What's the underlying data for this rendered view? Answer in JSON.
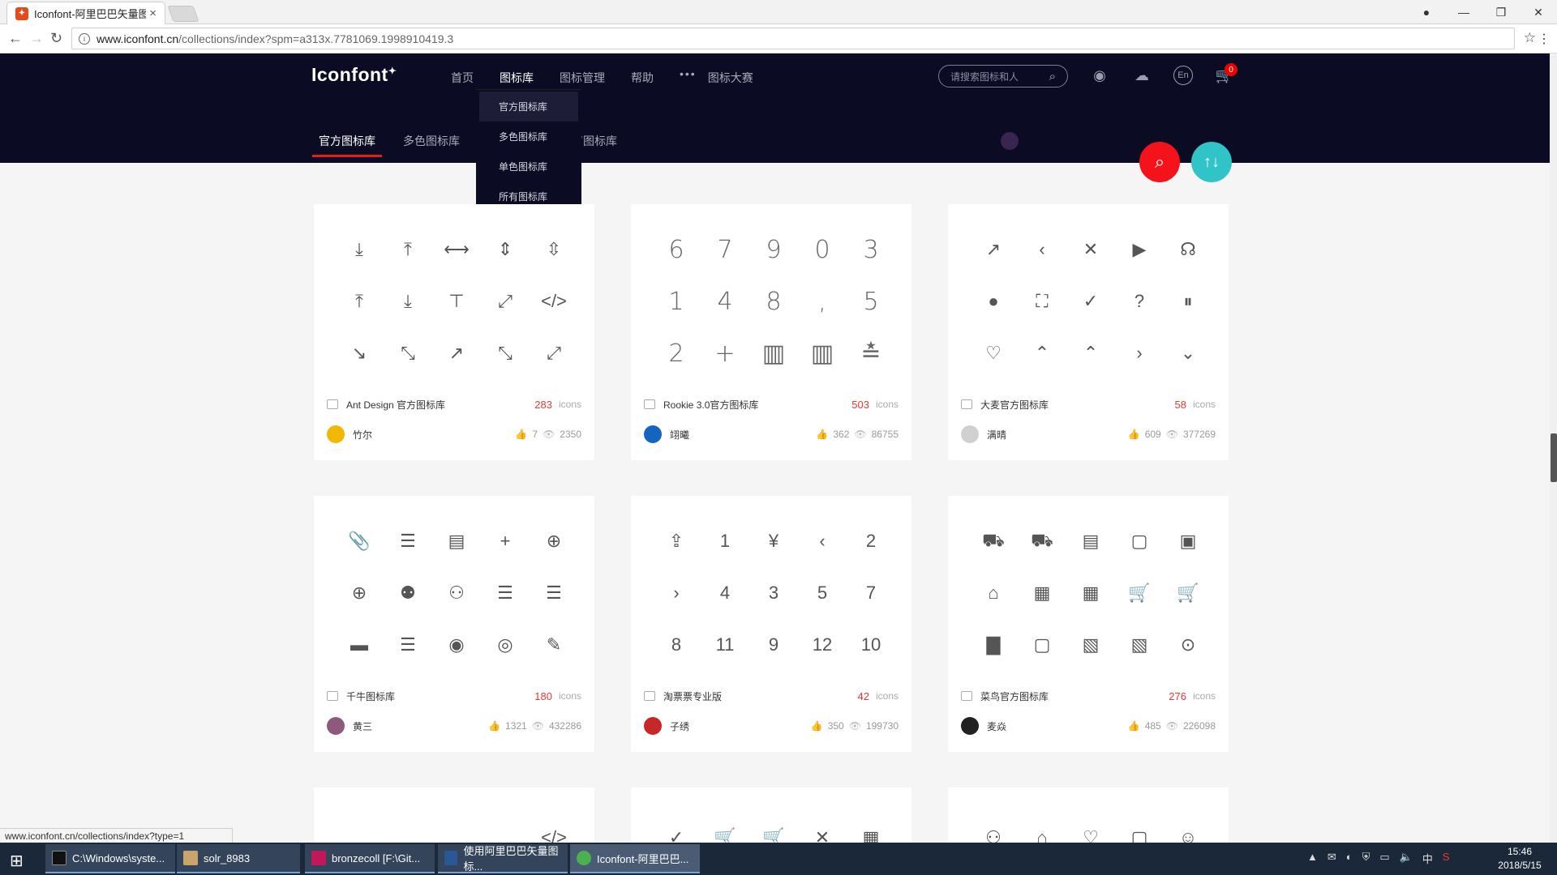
{
  "browser": {
    "tab_title": "Iconfont-阿里巴巴矢量图标",
    "tab_close": "×",
    "url_host": "www.iconfont.cn",
    "url_path": "/collections/index?spm=a313x.7781069.1998910419.3",
    "status_url": "www.iconfont.cn/collections/index?type=1"
  },
  "site": {
    "logo": "Iconfont",
    "nav": [
      "首页",
      "图标库",
      "图标管理",
      "帮助",
      "图标大赛"
    ],
    "nav_more": "•••",
    "search_placeholder": "请搜索图标和人",
    "lang": "En",
    "cart_count": "0",
    "subnav": [
      "官方图标库",
      "多色图标库",
      "所有图标库"
    ],
    "dropdown": [
      "官方图标库",
      "多色图标库",
      "单色图标库",
      "所有图标库"
    ]
  },
  "cards": [
    {
      "name": "Ant Design 官方图标库",
      "count": "283",
      "label": "icons",
      "author": "竹尔",
      "likes": "7",
      "views": "2350",
      "icons": [
        "⤓",
        "⤒",
        "⟷",
        "⇕",
        "⇳",
        "⤒",
        "⤓",
        "⊤",
        "⤢",
        "</>",
        "↘",
        "⤡",
        "↗",
        "⤡",
        "⤢"
      ],
      "avatar_color": "#f2b705"
    },
    {
      "name": "Rookie 3.0官方图标库",
      "count": "503",
      "label": "icons",
      "author": "翊曦",
      "likes": "362",
      "views": "86755",
      "icons": [
        "6",
        "7",
        "9",
        "0",
        "3",
        "1",
        "4",
        "8",
        ",",
        "5",
        "2",
        "+",
        "▥",
        "▥",
        "≛"
      ],
      "avatar_color": "#1565c0",
      "numeric": true
    },
    {
      "name": "大麦官方图标库",
      "count": "58",
      "label": "icons",
      "author": "满晴",
      "likes": "609",
      "views": "377269",
      "icons": [
        "↗",
        "‹",
        "✕",
        "▶",
        "☊",
        "●",
        "⛶",
        "✓",
        "?",
        "⏸",
        "♡",
        "⌃",
        "⌃",
        "›",
        "⌄"
      ],
      "avatar_color": "#d0d0d0"
    },
    {
      "name": "千牛图标库",
      "count": "180",
      "label": "icons",
      "author": "黄三",
      "likes": "1321",
      "views": "432286",
      "icons": [
        "📎",
        "☰",
        "▤",
        "+",
        "⊕",
        "⊕",
        "⚉",
        "⚇",
        "☰",
        "☰",
        "▬",
        "☰",
        "◉",
        "◎",
        "✎"
      ],
      "avatar_color": "#8e5a7c"
    },
    {
      "name": "淘票票专业版",
      "count": "42",
      "label": "icons",
      "author": "子绣",
      "likes": "350",
      "views": "199730",
      "icons": [
        "⇪",
        "1",
        "¥",
        "‹",
        "2",
        "›",
        "4",
        "3",
        "5",
        "7",
        "8",
        "11",
        "9",
        "12",
        "10"
      ],
      "avatar_color": "#c62828"
    },
    {
      "name": "菜鸟官方图标库",
      "count": "276",
      "label": "icons",
      "author": "麦焱",
      "likes": "485",
      "views": "226098",
      "icons": [
        "⛟",
        "⛟",
        "▤",
        "▢",
        "▣",
        "⌂",
        "▦",
        "▦",
        "🛒",
        "🛒",
        "▇",
        "▢",
        "▧",
        "▧",
        "⊙"
      ],
      "avatar_color": "#222222"
    }
  ],
  "bottom_row_icons": [
    [
      "",
      "",
      "",
      "</>"
    ],
    [
      "✓",
      "🛒",
      "🛒",
      "✕",
      "▦"
    ],
    [
      "⚇",
      "⌂",
      "♡",
      "▢",
      "☺"
    ]
  ],
  "taskbar": {
    "items": [
      "C:\\Windows\\syste...",
      "solr_8983",
      "bronzecoll [F:\\Git...",
      "使用阿里巴巴矢量图标...",
      "Iconfont-阿里巴巴..."
    ],
    "ime": "中",
    "time": "15:46",
    "date": "2018/5/15"
  }
}
